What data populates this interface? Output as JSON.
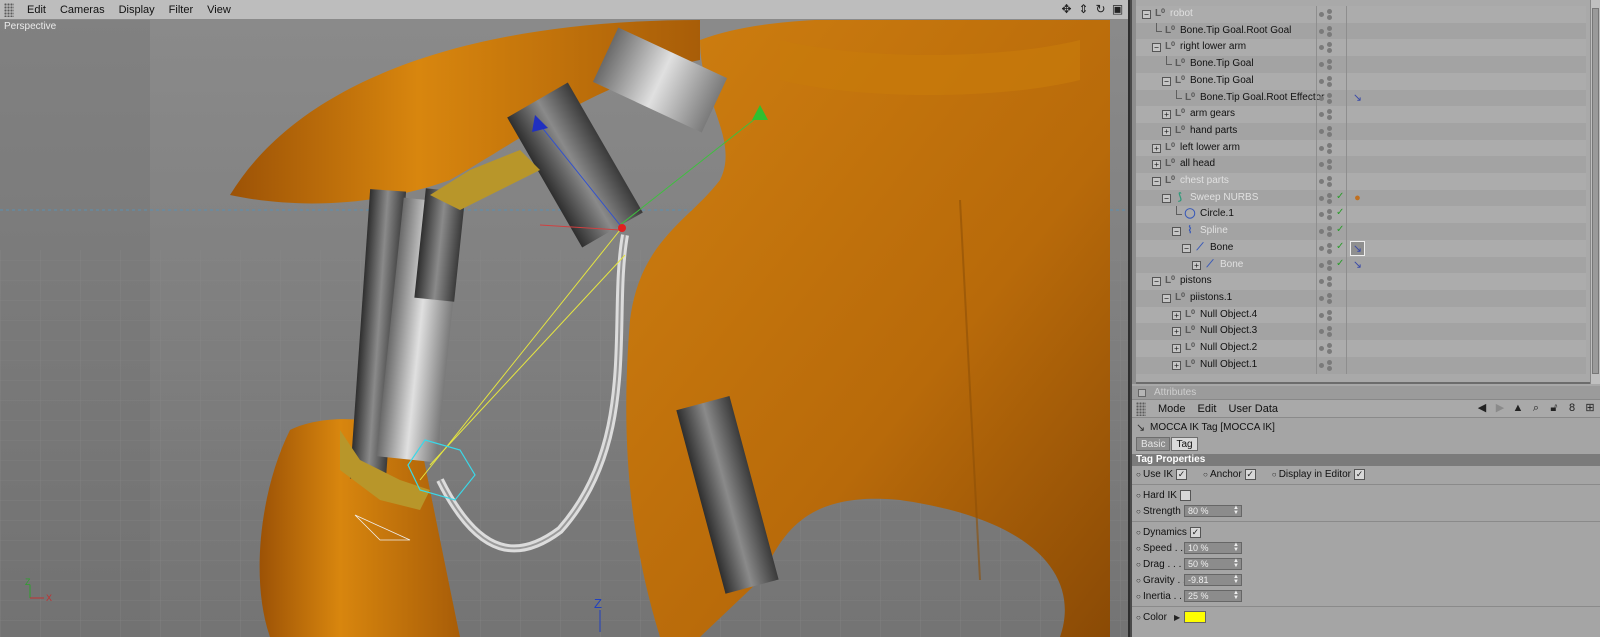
{
  "viewport": {
    "menus": [
      "Edit",
      "Cameras",
      "Display",
      "Filter",
      "View"
    ],
    "label": "Perspective",
    "nav_icons": [
      "move-view-icon",
      "scroll-view-icon",
      "rotate-view-icon",
      "maximize-view-icon"
    ]
  },
  "object_manager": {
    "rows": [
      {
        "name": "robot",
        "depth": 0,
        "expander": "−",
        "dim": true
      },
      {
        "name": "Bone.Tip Goal.Root Goal",
        "depth": 1,
        "expander": ""
      },
      {
        "name": "right lower arm",
        "depth": 1,
        "expander": "−"
      },
      {
        "name": "Bone.Tip Goal",
        "depth": 2,
        "expander": ""
      },
      {
        "name": "Bone.Tip Goal",
        "depth": 2,
        "expander": "−"
      },
      {
        "name": "Bone.Tip Goal.Root Effector",
        "depth": 3,
        "expander": "",
        "tag": "ik-tag-icon"
      },
      {
        "name": "arm gears",
        "depth": 2,
        "expander": "+"
      },
      {
        "name": "hand parts",
        "depth": 2,
        "expander": "+"
      },
      {
        "name": "left lower arm",
        "depth": 1,
        "expander": "+"
      },
      {
        "name": "all head",
        "depth": 1,
        "expander": "+"
      },
      {
        "name": "chest parts",
        "depth": 1,
        "expander": "−",
        "dim": true
      },
      {
        "name": "Sweep NURBS",
        "depth": 2,
        "expander": "−",
        "dim": true,
        "check": true,
        "tag": "material-tag-icon",
        "icon": "sweep-nurbs-icon"
      },
      {
        "name": "Circle.1",
        "depth": 3,
        "expander": "",
        "check": true,
        "icon": "circle-spline-icon"
      },
      {
        "name": "Spline",
        "depth": 3,
        "expander": "−",
        "dim": true,
        "check": true,
        "icon": "spline-icon"
      },
      {
        "name": "Bone",
        "depth": 4,
        "expander": "−",
        "check": true,
        "tag": "ik-tag-selected-icon",
        "icon": "bone-icon"
      },
      {
        "name": "Bone",
        "depth": 5,
        "expander": "+",
        "dim": true,
        "check": true,
        "tag": "ik-tag-icon",
        "icon": "bone-icon"
      },
      {
        "name": "pistons",
        "depth": 1,
        "expander": "−"
      },
      {
        "name": "piistons.1",
        "depth": 2,
        "expander": "−"
      },
      {
        "name": "Null Object.4",
        "depth": 3,
        "expander": "+"
      },
      {
        "name": "Null Object.3",
        "depth": 3,
        "expander": "+"
      },
      {
        "name": "Null Object.2",
        "depth": 3,
        "expander": "+"
      },
      {
        "name": "Null Object.1",
        "depth": 3,
        "expander": "+"
      }
    ]
  },
  "attributes": {
    "title": "Attributes",
    "menus": [
      "Mode",
      "Edit",
      "User Data"
    ],
    "tag_title": "MOCCA IK Tag [MOCCA IK]",
    "tabs": [
      "Basic",
      "Tag"
    ],
    "section": "Tag Properties",
    "use_ik": "Use IK",
    "anchor": "Anchor",
    "display_in_editor": "Display in Editor",
    "hard_ik": "Hard IK",
    "strength_label": "Strength",
    "strength_value": "80 %",
    "dynamics": "Dynamics",
    "speed_label": "Speed . .",
    "speed_value": "10 %",
    "drag_label": "Drag . . . .",
    "drag_value": "50 %",
    "gravity_label": "Gravity . .",
    "gravity_value": "-9.81",
    "inertia_label": "Inertia . .",
    "inertia_value": "25 %",
    "color_label": "Color",
    "color_value": "#ffff00"
  },
  "axes": {
    "z": "Z",
    "x": "X"
  }
}
